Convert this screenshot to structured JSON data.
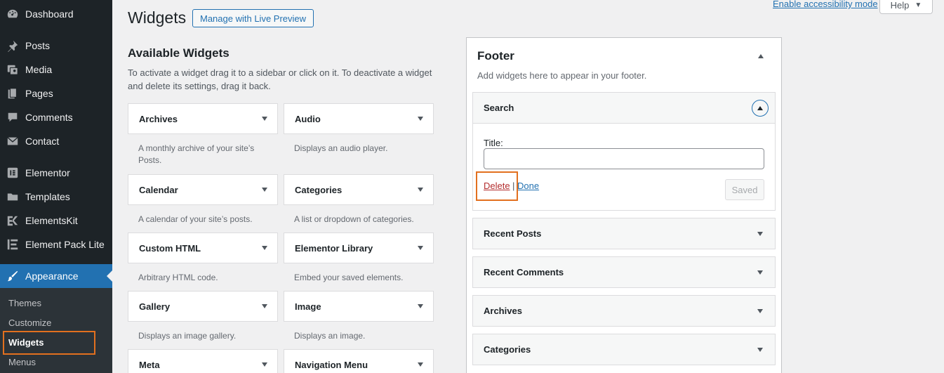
{
  "sidebar": {
    "items": [
      {
        "label": "Dashboard",
        "icon": "dashboard-icon"
      },
      {
        "label": "Posts",
        "icon": "pin-icon"
      },
      {
        "label": "Media",
        "icon": "media-icon"
      },
      {
        "label": "Pages",
        "icon": "pages-icon"
      },
      {
        "label": "Comments",
        "icon": "comment-icon"
      },
      {
        "label": "Contact",
        "icon": "mail-icon"
      },
      {
        "label": "Elementor",
        "icon": "elementor-icon"
      },
      {
        "label": "Templates",
        "icon": "folder-icon"
      },
      {
        "label": "ElementsKit",
        "icon": "elementskit-icon"
      },
      {
        "label": "Element Pack Lite",
        "icon": "element-pack-icon"
      },
      {
        "label": "Appearance",
        "icon": "brush-icon"
      }
    ],
    "submenu": [
      "Themes",
      "Customize",
      "Widgets",
      "Menus"
    ]
  },
  "header": {
    "title": "Widgets",
    "live_preview": "Manage with Live Preview",
    "a11y": "Enable accessibility mode",
    "help": "Help"
  },
  "available": {
    "title": "Available Widgets",
    "desc": "To activate a widget drag it to a sidebar or click on it. To deactivate a widget and delete its settings, drag it back.",
    "widgets": [
      {
        "name": "Archives",
        "desc": "A monthly archive of your site’s Posts."
      },
      {
        "name": "Audio",
        "desc": "Displays an audio player."
      },
      {
        "name": "Calendar",
        "desc": "A calendar of your site’s posts."
      },
      {
        "name": "Categories",
        "desc": "A list or dropdown of categories."
      },
      {
        "name": "Custom HTML",
        "desc": "Arbitrary HTML code."
      },
      {
        "name": "Elementor Library",
        "desc": "Embed your saved elements."
      },
      {
        "name": "Gallery",
        "desc": "Displays an image gallery."
      },
      {
        "name": "Image",
        "desc": "Displays an image."
      },
      {
        "name": "Meta",
        "desc": ""
      },
      {
        "name": "Navigation Menu",
        "desc": ""
      }
    ]
  },
  "footer": {
    "title": "Footer",
    "desc": "Add widgets here to appear in your footer.",
    "search": {
      "name": "Search",
      "title_label": "Title:",
      "title_value": "",
      "delete": "Delete",
      "sep": "|",
      "done": "Done",
      "saved": "Saved"
    },
    "widgets": [
      "Recent Posts",
      "Recent Comments",
      "Archives",
      "Categories"
    ]
  },
  "colors": {
    "sidebar_bg": "#1d2327",
    "accent": "#2271b1",
    "highlight": "#e2701f",
    "delete": "#b32d2e"
  }
}
